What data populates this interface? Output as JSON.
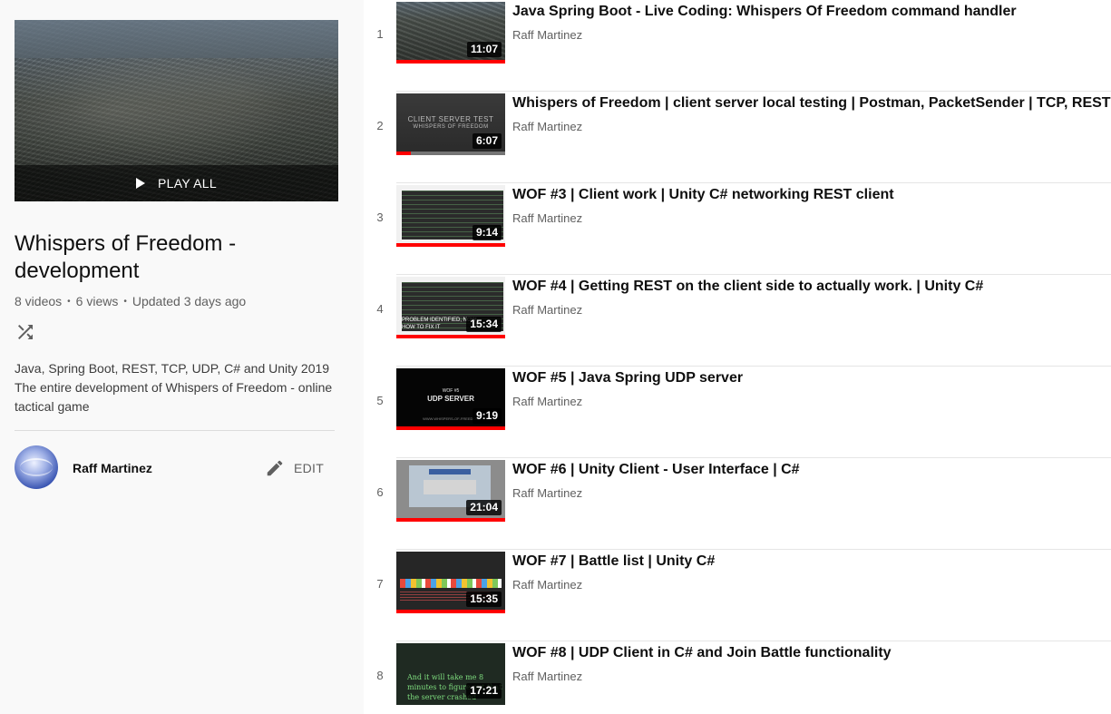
{
  "playlist": {
    "play_all_label": "PLAY ALL",
    "title": "Whispers of Freedom - development",
    "video_count": "8 videos",
    "views": "6 views",
    "updated": "Updated 3 days ago",
    "description_line1": "Java, Spring Boot, REST, TCP, UDP, C# and Unity 2019",
    "description_line2": "The entire development of Whispers of Freedom - online tactical game",
    "owner": "Raff Martinez",
    "edit_label": "EDIT",
    "icons": [
      "play-icon",
      "shuffle-icon",
      "pencil-icon"
    ]
  },
  "videos": [
    {
      "index": "1",
      "title": "Java Spring Boot - Live Coding: Whispers Of Freedom command handler",
      "channel": "Raff Martinez",
      "duration": "11:07",
      "watched": 1.0,
      "thumb_text": ""
    },
    {
      "index": "2",
      "title": "Whispers of Freedom | client server local testing | Postman, PacketSender | TCP, REST",
      "channel": "Raff Martinez",
      "duration": "6:07",
      "watched": 0.13,
      "thumb_text": "CLIENT SERVER TEST",
      "thumb_text2": "WHISPERS OF FREEDOM"
    },
    {
      "index": "3",
      "title": "WOF #3 | Client work | Unity C# networking REST client",
      "channel": "Raff Martinez",
      "duration": "9:14",
      "watched": 1.0,
      "thumb_text": ""
    },
    {
      "index": "4",
      "title": "WOF #4 | Getting REST on the client side to actually work. | Unity C#",
      "channel": "Raff Martinez",
      "duration": "15:34",
      "watched": 1.0,
      "thumb_text": "PROBLEM IDENTIFIED, NOW",
      "thumb_text2": "HOW TO FIX IT"
    },
    {
      "index": "5",
      "title": "WOF #5 | Java Spring UDP server",
      "channel": "Raff Martinez",
      "duration": "9:19",
      "watched": 1.0,
      "thumb_text": "WOF #5",
      "thumb_text2": "UDP SERVER",
      "thumb_text3": "WWW.WHISPERS-OF-FREEDOM"
    },
    {
      "index": "6",
      "title": "WOF #6 | Unity Client - User Interface | C#",
      "channel": "Raff Martinez",
      "duration": "21:04",
      "watched": 1.0,
      "thumb_text": ""
    },
    {
      "index": "7",
      "title": "WOF #7 | Battle list | Unity C#",
      "channel": "Raff Martinez",
      "duration": "15:35",
      "watched": 1.0,
      "thumb_text": ""
    },
    {
      "index": "8",
      "title": "WOF #8 | UDP Client in C# and Join Battle functionality",
      "channel": "Raff Martinez",
      "duration": "17:21",
      "watched": 0.0,
      "thumb_text": "And it will take me 8",
      "thumb_text2": "minutes to figure out that",
      "thumb_text3": "the server crashed"
    }
  ],
  "colors": {
    "progress": "#ff0000",
    "background": "#f9f9f9",
    "secondary_text": "#606060"
  }
}
